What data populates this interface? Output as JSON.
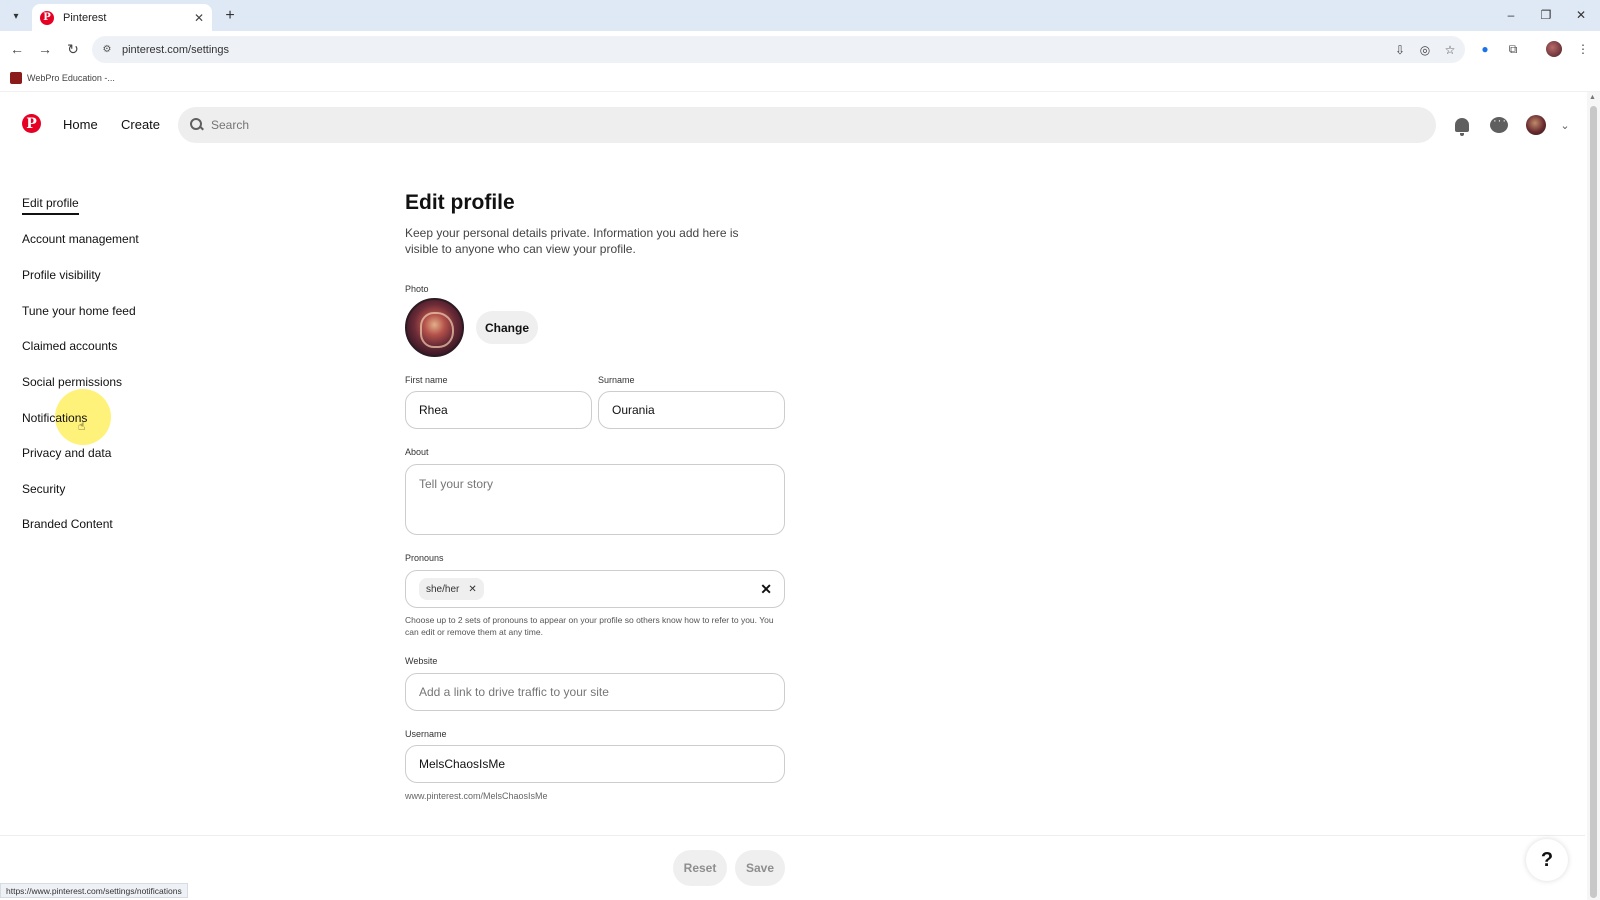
{
  "browser": {
    "tab_title": "Pinterest",
    "url": "pinterest.com/settings",
    "bookmark": "WebPro Education -...",
    "status_url": "https://www.pinterest.com/settings/notifications"
  },
  "header": {
    "nav": {
      "home": "Home",
      "create": "Create"
    },
    "search_placeholder": "Search"
  },
  "sidebar": {
    "items": [
      {
        "label": "Edit profile",
        "active": true
      },
      {
        "label": "Account management"
      },
      {
        "label": "Profile visibility"
      },
      {
        "label": "Tune your home feed"
      },
      {
        "label": "Claimed accounts"
      },
      {
        "label": "Social permissions"
      },
      {
        "label": "Notifications"
      },
      {
        "label": "Privacy and data"
      },
      {
        "label": "Security"
      },
      {
        "label": "Branded Content"
      }
    ]
  },
  "form": {
    "title": "Edit profile",
    "intro": "Keep your personal details private. Information you add here is visible to anyone who can view your profile.",
    "photo_label": "Photo",
    "change_label": "Change",
    "first_name_label": "First name",
    "first_name": "Rhea",
    "surname_label": "Surname",
    "surname": "Ourania",
    "about_label": "About",
    "about_placeholder": "Tell your story",
    "pronouns_label": "Pronouns",
    "pronoun_chip": "she/her",
    "pronouns_help": "Choose up to 2 sets of pronouns to appear on your profile so others know how to refer to you. You can edit or remove them at any time.",
    "website_label": "Website",
    "website_placeholder": "Add a link to drive traffic to your site",
    "username_label": "Username",
    "username": "MelsChaosIsMe",
    "profile_url": "www.pinterest.com/MelsChaosIsMe"
  },
  "footer": {
    "reset": "Reset",
    "save": "Save"
  },
  "colors": {
    "brand": "#e60023",
    "highlight": "#ffeb32"
  }
}
